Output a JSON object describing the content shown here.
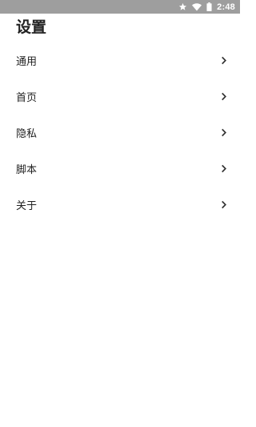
{
  "status_bar": {
    "time": "2:48",
    "icons": [
      "star-icon",
      "wifi-icon",
      "battery-icon"
    ],
    "background": "#9e9e9e"
  },
  "page": {
    "title": "设置"
  },
  "menu": {
    "items": [
      {
        "label": "通用",
        "icon": "chevron-right-icon"
      },
      {
        "label": "首页",
        "icon": "chevron-right-icon"
      },
      {
        "label": "隐私",
        "icon": "chevron-right-icon"
      },
      {
        "label": "脚本",
        "icon": "chevron-right-icon"
      },
      {
        "label": "关于",
        "icon": "chevron-right-icon"
      }
    ]
  }
}
